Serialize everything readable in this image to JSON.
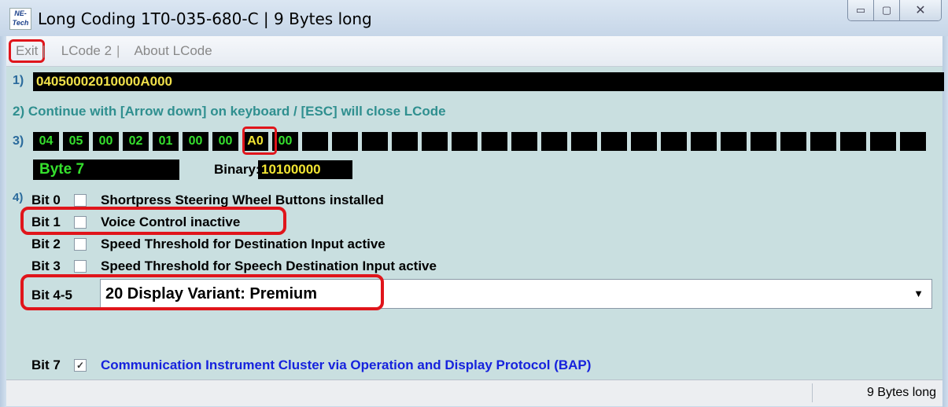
{
  "window": {
    "app_icon_text": "NE-Tech",
    "title": "Long Coding  1T0-035-680-C | 9 Bytes long",
    "minimize": "▭",
    "maximize": "▢",
    "close": "✕"
  },
  "menu": {
    "exit": "Exit",
    "sep1": "|",
    "lcode2": "LCode 2",
    "sep2": "|",
    "about": "About LCode"
  },
  "steps": {
    "s1": "1)",
    "s2": "2) Continue with [Arrow down] on keyboard / [ESC] will close LCode",
    "s3": "3)",
    "s4": "4)"
  },
  "coding_string": "04050002010000A000",
  "bytes": [
    "04",
    "05",
    "00",
    "02",
    "01",
    "00",
    "00",
    "A0",
    "00",
    "",
    "",
    "",
    "",
    "",
    "",
    "",
    "",
    "",
    "",
    "",
    "",
    "",
    "",
    "",
    "",
    "",
    "",
    "",
    "",
    ""
  ],
  "selected_byte_index": 7,
  "byte_label": "Byte 7",
  "binary_label": "Binary:",
  "binary_value": "10100000",
  "bits": [
    {
      "num": "Bit 0",
      "checked": false,
      "desc": "Shortpress Steering Wheel Buttons installed"
    },
    {
      "num": "Bit 1",
      "checked": false,
      "desc": "Voice Control inactive"
    },
    {
      "num": "Bit 2",
      "checked": false,
      "desc": "Speed Threshold for Destination Input active"
    },
    {
      "num": "Bit 3",
      "checked": false,
      "desc": "Speed Threshold for Speech Destination Input active"
    }
  ],
  "bit45": {
    "label": "Bit 4-5",
    "value": "20 Display Variant: Premium"
  },
  "bit7": {
    "num": "Bit 7",
    "checked": true,
    "check_mark": "✓",
    "desc": "Communication Instrument Cluster via Operation and Display Protocol (BAP)"
  },
  "status": {
    "right": "9 Bytes long"
  },
  "colors": {
    "highlight": "#e0151b",
    "byte_text": "#35e02d",
    "selected_byte_text": "#f2e532",
    "link_blue": "#1622dd"
  }
}
